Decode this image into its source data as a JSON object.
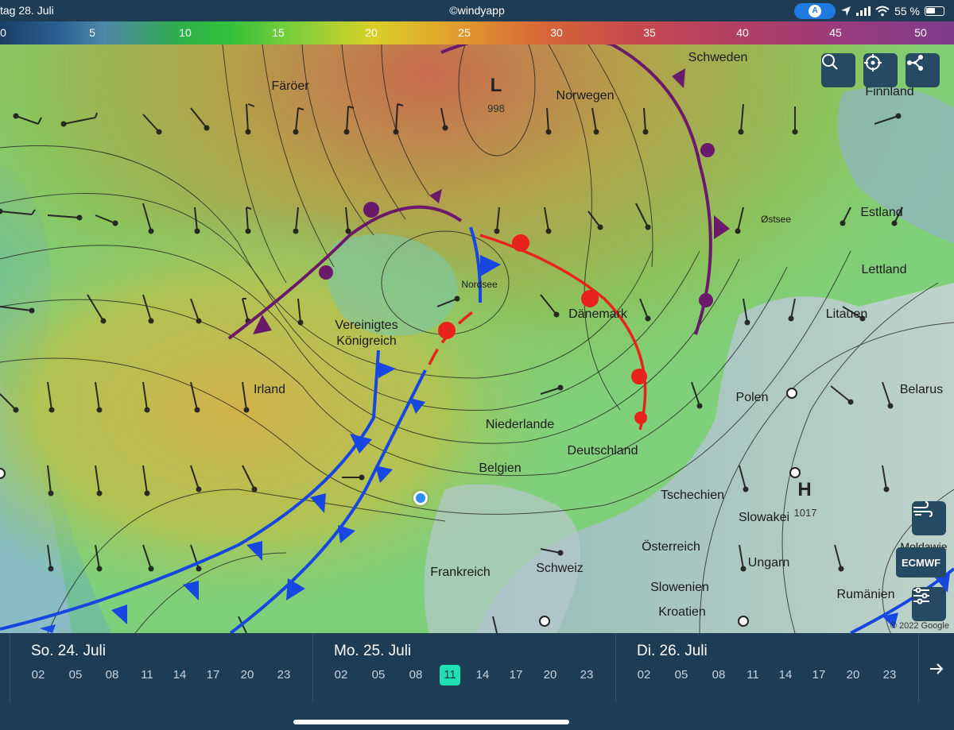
{
  "status": {
    "date": "tag 28. Juli",
    "app": "©windyapp",
    "location_badge": "A",
    "battery": "55 %"
  },
  "scale": {
    "values": [
      "0",
      "5",
      "10",
      "15",
      "20",
      "25",
      "30",
      "35",
      "40",
      "45",
      "50"
    ]
  },
  "map": {
    "labels": {
      "faroer": "Färöer",
      "norwegen": "Norwegen",
      "schweden": "Schweden",
      "finnland": "Finnland",
      "estland": "Estland",
      "lettland": "Lettland",
      "litauen": "Litauen",
      "belarus": "Belarus",
      "polen": "Polen",
      "ostsee": "Østsee",
      "nordsee": "Nordsee",
      "vk": "Vereinigtes\nKönigreich",
      "irland": "Irland",
      "daenemark": "Dänemark",
      "niederlande": "Niederlande",
      "deutschland": "Deutschland",
      "belgien": "Belgien",
      "tschechien": "Tschechien",
      "slowakei": "Slowakei",
      "oesterreich": "Österreich",
      "ungarn": "Ungarn",
      "frankreich": "Frankreich",
      "schweiz": "Schweiz",
      "slowenien": "Slowenien",
      "kroatien": "Kroatien",
      "rumaenien": "Rumänien",
      "moldawien": "Moldawie"
    },
    "low": {
      "letter": "L",
      "pressure": "998"
    },
    "high": {
      "letter": "H",
      "pressure": "1017"
    },
    "copyright": "© 2022 Google",
    "colors": {
      "cold_front": "#1747e0",
      "warm_front": "#e8231c",
      "occluded_front": "#6b1a6b",
      "isobar": "#1a1a1a"
    },
    "icons": [
      "search-icon",
      "crosshair-icon",
      "share-icon",
      "wind-layer-icon",
      "filter-sliders-icon"
    ]
  },
  "model_button": "ECMWF",
  "timeline": {
    "days": [
      {
        "title": "So. 24. Juli",
        "hours": [
          "02",
          "05",
          "08",
          "11",
          "14",
          "17",
          "20",
          "23"
        ]
      },
      {
        "title": "Mo. 25. Juli",
        "hours": [
          "02",
          "05",
          "08",
          "11",
          "14",
          "17",
          "20",
          "23"
        ]
      },
      {
        "title": "Di. 26. Juli",
        "hours": [
          "02",
          "05",
          "08",
          "11",
          "14",
          "17",
          "20",
          "23"
        ]
      }
    ],
    "selected": {
      "day": "Mo. 25. Juli",
      "hour": "11"
    },
    "next_icon": "arrow-right-icon"
  }
}
